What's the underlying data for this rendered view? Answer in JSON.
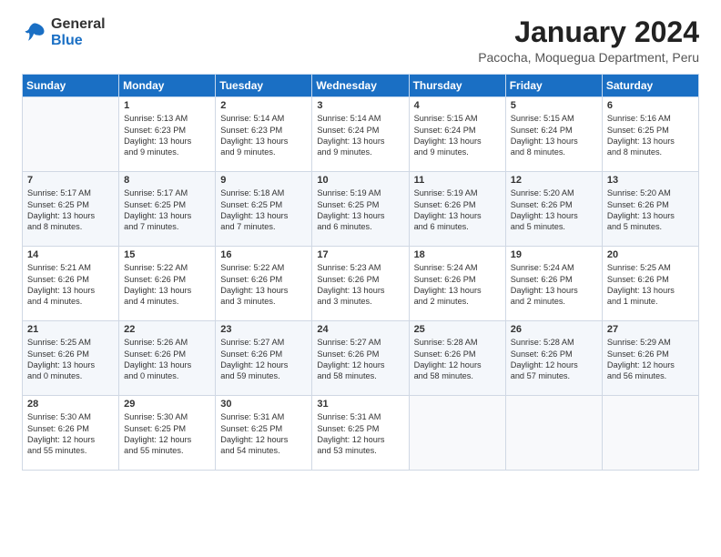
{
  "logo": {
    "general": "General",
    "blue": "Blue"
  },
  "title": "January 2024",
  "location": "Pacocha, Moquegua Department, Peru",
  "days_of_week": [
    "Sunday",
    "Monday",
    "Tuesday",
    "Wednesday",
    "Thursday",
    "Friday",
    "Saturday"
  ],
  "weeks": [
    [
      {
        "day": "",
        "lines": []
      },
      {
        "day": "1",
        "lines": [
          "Sunrise: 5:13 AM",
          "Sunset: 6:23 PM",
          "Daylight: 13 hours",
          "and 9 minutes."
        ]
      },
      {
        "day": "2",
        "lines": [
          "Sunrise: 5:14 AM",
          "Sunset: 6:23 PM",
          "Daylight: 13 hours",
          "and 9 minutes."
        ]
      },
      {
        "day": "3",
        "lines": [
          "Sunrise: 5:14 AM",
          "Sunset: 6:24 PM",
          "Daylight: 13 hours",
          "and 9 minutes."
        ]
      },
      {
        "day": "4",
        "lines": [
          "Sunrise: 5:15 AM",
          "Sunset: 6:24 PM",
          "Daylight: 13 hours",
          "and 9 minutes."
        ]
      },
      {
        "day": "5",
        "lines": [
          "Sunrise: 5:15 AM",
          "Sunset: 6:24 PM",
          "Daylight: 13 hours",
          "and 8 minutes."
        ]
      },
      {
        "day": "6",
        "lines": [
          "Sunrise: 5:16 AM",
          "Sunset: 6:25 PM",
          "Daylight: 13 hours",
          "and 8 minutes."
        ]
      }
    ],
    [
      {
        "day": "7",
        "lines": [
          "Sunrise: 5:17 AM",
          "Sunset: 6:25 PM",
          "Daylight: 13 hours",
          "and 8 minutes."
        ]
      },
      {
        "day": "8",
        "lines": [
          "Sunrise: 5:17 AM",
          "Sunset: 6:25 PM",
          "Daylight: 13 hours",
          "and 7 minutes."
        ]
      },
      {
        "day": "9",
        "lines": [
          "Sunrise: 5:18 AM",
          "Sunset: 6:25 PM",
          "Daylight: 13 hours",
          "and 7 minutes."
        ]
      },
      {
        "day": "10",
        "lines": [
          "Sunrise: 5:19 AM",
          "Sunset: 6:25 PM",
          "Daylight: 13 hours",
          "and 6 minutes."
        ]
      },
      {
        "day": "11",
        "lines": [
          "Sunrise: 5:19 AM",
          "Sunset: 6:26 PM",
          "Daylight: 13 hours",
          "and 6 minutes."
        ]
      },
      {
        "day": "12",
        "lines": [
          "Sunrise: 5:20 AM",
          "Sunset: 6:26 PM",
          "Daylight: 13 hours",
          "and 5 minutes."
        ]
      },
      {
        "day": "13",
        "lines": [
          "Sunrise: 5:20 AM",
          "Sunset: 6:26 PM",
          "Daylight: 13 hours",
          "and 5 minutes."
        ]
      }
    ],
    [
      {
        "day": "14",
        "lines": [
          "Sunrise: 5:21 AM",
          "Sunset: 6:26 PM",
          "Daylight: 13 hours",
          "and 4 minutes."
        ]
      },
      {
        "day": "15",
        "lines": [
          "Sunrise: 5:22 AM",
          "Sunset: 6:26 PM",
          "Daylight: 13 hours",
          "and 4 minutes."
        ]
      },
      {
        "day": "16",
        "lines": [
          "Sunrise: 5:22 AM",
          "Sunset: 6:26 PM",
          "Daylight: 13 hours",
          "and 3 minutes."
        ]
      },
      {
        "day": "17",
        "lines": [
          "Sunrise: 5:23 AM",
          "Sunset: 6:26 PM",
          "Daylight: 13 hours",
          "and 3 minutes."
        ]
      },
      {
        "day": "18",
        "lines": [
          "Sunrise: 5:24 AM",
          "Sunset: 6:26 PM",
          "Daylight: 13 hours",
          "and 2 minutes."
        ]
      },
      {
        "day": "19",
        "lines": [
          "Sunrise: 5:24 AM",
          "Sunset: 6:26 PM",
          "Daylight: 13 hours",
          "and 2 minutes."
        ]
      },
      {
        "day": "20",
        "lines": [
          "Sunrise: 5:25 AM",
          "Sunset: 6:26 PM",
          "Daylight: 13 hours",
          "and 1 minute."
        ]
      }
    ],
    [
      {
        "day": "21",
        "lines": [
          "Sunrise: 5:25 AM",
          "Sunset: 6:26 PM",
          "Daylight: 13 hours",
          "and 0 minutes."
        ]
      },
      {
        "day": "22",
        "lines": [
          "Sunrise: 5:26 AM",
          "Sunset: 6:26 PM",
          "Daylight: 13 hours",
          "and 0 minutes."
        ]
      },
      {
        "day": "23",
        "lines": [
          "Sunrise: 5:27 AM",
          "Sunset: 6:26 PM",
          "Daylight: 12 hours",
          "and 59 minutes."
        ]
      },
      {
        "day": "24",
        "lines": [
          "Sunrise: 5:27 AM",
          "Sunset: 6:26 PM",
          "Daylight: 12 hours",
          "and 58 minutes."
        ]
      },
      {
        "day": "25",
        "lines": [
          "Sunrise: 5:28 AM",
          "Sunset: 6:26 PM",
          "Daylight: 12 hours",
          "and 58 minutes."
        ]
      },
      {
        "day": "26",
        "lines": [
          "Sunrise: 5:28 AM",
          "Sunset: 6:26 PM",
          "Daylight: 12 hours",
          "and 57 minutes."
        ]
      },
      {
        "day": "27",
        "lines": [
          "Sunrise: 5:29 AM",
          "Sunset: 6:26 PM",
          "Daylight: 12 hours",
          "and 56 minutes."
        ]
      }
    ],
    [
      {
        "day": "28",
        "lines": [
          "Sunrise: 5:30 AM",
          "Sunset: 6:26 PM",
          "Daylight: 12 hours",
          "and 55 minutes."
        ]
      },
      {
        "day": "29",
        "lines": [
          "Sunrise: 5:30 AM",
          "Sunset: 6:25 PM",
          "Daylight: 12 hours",
          "and 55 minutes."
        ]
      },
      {
        "day": "30",
        "lines": [
          "Sunrise: 5:31 AM",
          "Sunset: 6:25 PM",
          "Daylight: 12 hours",
          "and 54 minutes."
        ]
      },
      {
        "day": "31",
        "lines": [
          "Sunrise: 5:31 AM",
          "Sunset: 6:25 PM",
          "Daylight: 12 hours",
          "and 53 minutes."
        ]
      },
      {
        "day": "",
        "lines": []
      },
      {
        "day": "",
        "lines": []
      },
      {
        "day": "",
        "lines": []
      }
    ]
  ]
}
